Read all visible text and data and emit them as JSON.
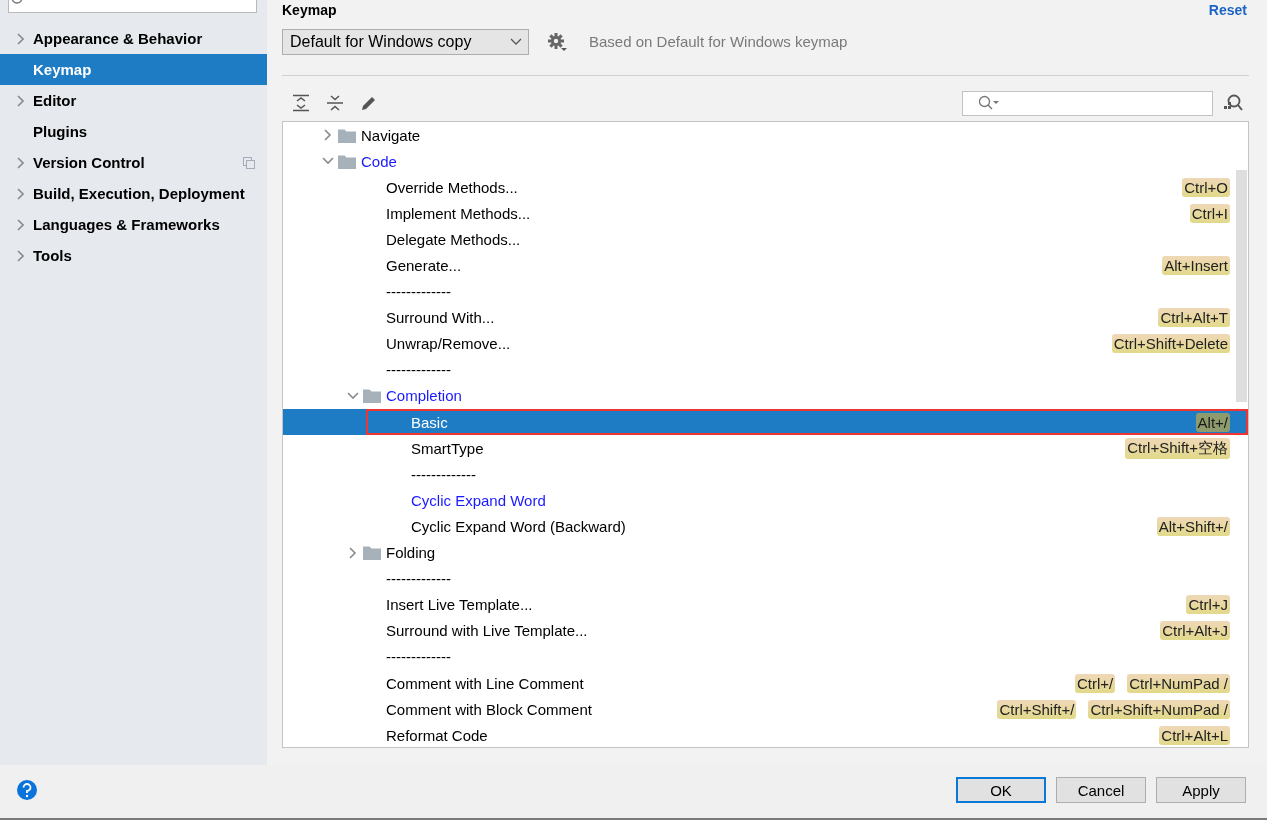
{
  "sidebar": {
    "items": [
      {
        "label": "Appearance & Behavior",
        "expandable": true,
        "selected": false,
        "project_level": false
      },
      {
        "label": "Keymap",
        "expandable": false,
        "selected": true,
        "project_level": false
      },
      {
        "label": "Editor",
        "expandable": true,
        "selected": false,
        "project_level": false
      },
      {
        "label": "Plugins",
        "expandable": false,
        "selected": false,
        "project_level": false
      },
      {
        "label": "Version Control",
        "expandable": true,
        "selected": false,
        "project_level": true
      },
      {
        "label": "Build, Execution, Deployment",
        "expandable": true,
        "selected": false,
        "project_level": false
      },
      {
        "label": "Languages & Frameworks",
        "expandable": true,
        "selected": false,
        "project_level": false
      },
      {
        "label": "Tools",
        "expandable": true,
        "selected": false,
        "project_level": false
      }
    ]
  },
  "page": {
    "title": "Keymap",
    "reset_link": "Reset"
  },
  "keymap_select": {
    "value": "Default for Windows copy"
  },
  "based_on": "Based on Default for Windows keymap",
  "tree": {
    "items": [
      {
        "kind": "folder",
        "label": "Navigate",
        "expanded": false,
        "modified": false,
        "selected": false
      },
      {
        "kind": "folder",
        "label": "Code",
        "expanded": true,
        "modified": true,
        "selected": false,
        "children": [
          {
            "kind": "action",
            "label": "Override Methods...",
            "shortcuts": [
              "Ctrl+O"
            ],
            "modified": false,
            "selected": false
          },
          {
            "kind": "action",
            "label": "Implement Methods...",
            "shortcuts": [
              "Ctrl+I"
            ],
            "modified": false,
            "selected": false
          },
          {
            "kind": "action",
            "label": "Delegate Methods...",
            "modified": false,
            "selected": false
          },
          {
            "kind": "action",
            "label": "Generate...",
            "shortcuts": [
              "Alt+Insert"
            ],
            "modified": false,
            "selected": false
          },
          {
            "kind": "separator",
            "label": "-------------",
            "selected": false
          },
          {
            "kind": "action",
            "label": "Surround With...",
            "shortcuts": [
              "Ctrl+Alt+T"
            ],
            "modified": false,
            "selected": false
          },
          {
            "kind": "action",
            "label": "Unwrap/Remove...",
            "shortcuts": [
              "Ctrl+Shift+Delete"
            ],
            "modified": false,
            "selected": false
          },
          {
            "kind": "separator",
            "label": "-------------",
            "selected": false
          },
          {
            "kind": "folder",
            "label": "Completion",
            "expanded": true,
            "modified": true,
            "selected": false,
            "children": [
              {
                "kind": "action",
                "label": "Basic",
                "shortcuts": [
                  "Alt+/"
                ],
                "modified": false,
                "selected": true,
                "annotated": true
              },
              {
                "kind": "action",
                "label": "SmartType",
                "shortcuts": [
                  "Ctrl+Shift+空格"
                ],
                "modified": false,
                "selected": false
              },
              {
                "kind": "separator",
                "label": "-------------",
                "selected": false
              },
              {
                "kind": "action",
                "label": "Cyclic Expand Word",
                "modified": true,
                "selected": false
              },
              {
                "kind": "action",
                "label": "Cyclic Expand Word (Backward)",
                "shortcuts": [
                  "Alt+Shift+/"
                ],
                "modified": false,
                "selected": false
              }
            ]
          },
          {
            "kind": "folder",
            "label": "Folding",
            "expanded": false,
            "modified": false,
            "selected": false
          },
          {
            "kind": "separator",
            "label": "-------------",
            "selected": false
          },
          {
            "kind": "action",
            "label": "Insert Live Template...",
            "shortcuts": [
              "Ctrl+J"
            ],
            "modified": false,
            "selected": false
          },
          {
            "kind": "action",
            "label": "Surround with Live Template...",
            "shortcuts": [
              "Ctrl+Alt+J"
            ],
            "modified": false,
            "selected": false
          },
          {
            "kind": "separator",
            "label": "-------------",
            "selected": false
          },
          {
            "kind": "action",
            "label": "Comment with Line Comment",
            "shortcuts": [
              "Ctrl+/",
              "Ctrl+NumPad /"
            ],
            "modified": false,
            "selected": false
          },
          {
            "kind": "action",
            "label": "Comment with Block Comment",
            "shortcuts": [
              "Ctrl+Shift+/",
              "Ctrl+Shift+NumPad /"
            ],
            "modified": false,
            "selected": false
          },
          {
            "kind": "action",
            "label": "Reformat Code",
            "shortcuts": [
              "Ctrl+Alt+L"
            ],
            "modified": false,
            "selected": false
          }
        ]
      }
    ]
  },
  "buttons": [
    {
      "label": "OK",
      "default": true
    },
    {
      "label": "Cancel",
      "default": false
    },
    {
      "label": "Apply",
      "default": false
    }
  ]
}
